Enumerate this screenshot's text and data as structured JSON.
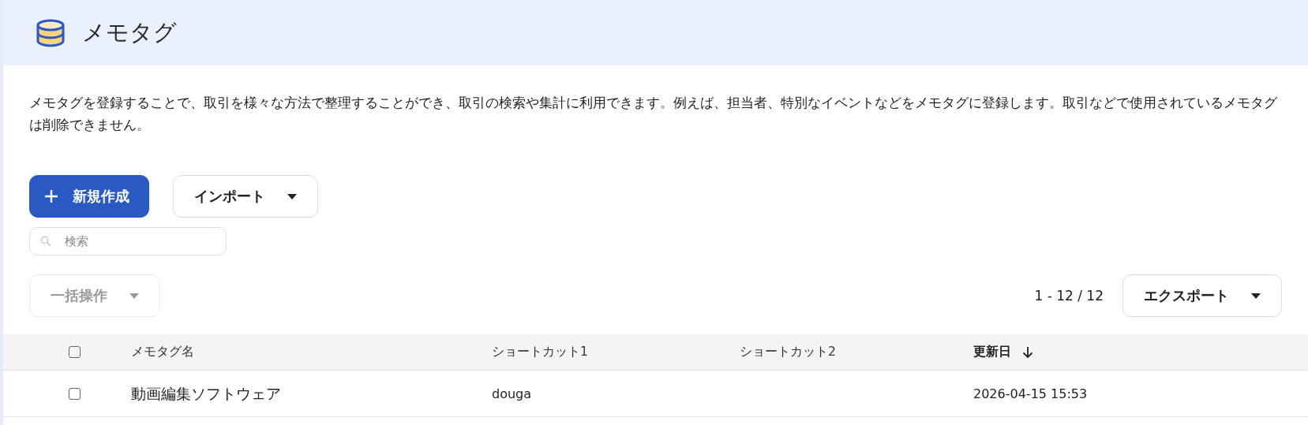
{
  "header": {
    "title": "メモタグ"
  },
  "description": "メモタグを登録することで、取引を様々な方法で整理することができ、取引の検索や集計に利用できます。例えば、担当者、特別なイベントなどをメモタグに登録します。取引などで使用されているメモタグは削除できません。",
  "actions": {
    "create_button": "新規作成",
    "import_button": "インポート"
  },
  "search": {
    "placeholder": "検索"
  },
  "bulk_button": {
    "label": "一括操作",
    "disabled": true
  },
  "count": "1 - 12 / 12",
  "export_button": "エクスポート",
  "table": {
    "all_checked": false,
    "columns": [
      {
        "label": "メモタグ名",
        "sorted": false
      },
      {
        "label": "ショートカット1",
        "sorted": false
      },
      {
        "label": "ショートカット2",
        "sorted": false
      },
      {
        "label": "更新日",
        "sorted": true
      }
    ],
    "rows": [
      {
        "checked": false,
        "cells": [
          "動画編集ソフトウェア",
          "douga",
          "",
          "2026-04-15 15:53"
        ]
      }
    ]
  }
}
